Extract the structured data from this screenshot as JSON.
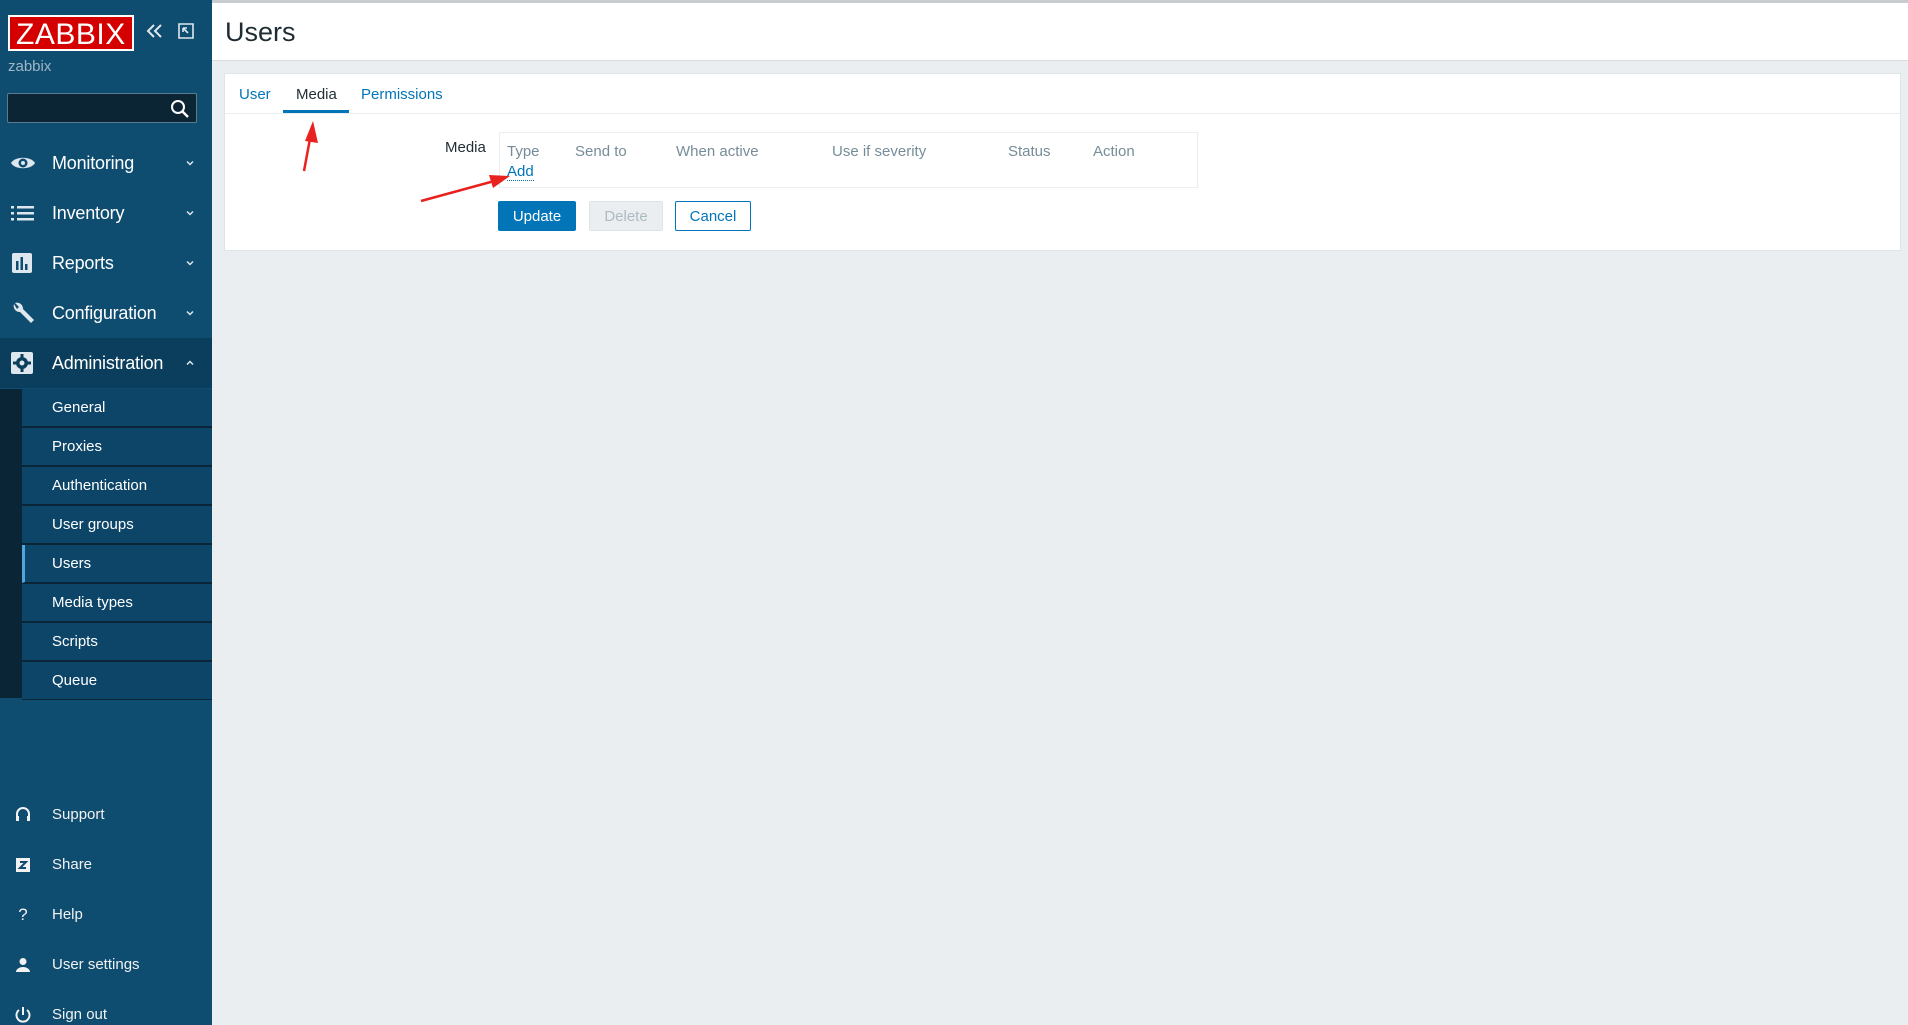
{
  "sidebar": {
    "logo": "ZABBIX",
    "server_name": "zabbix",
    "search": {
      "placeholder": "",
      "value": ""
    },
    "menu": [
      {
        "label": "Monitoring",
        "icon": "eye-icon"
      },
      {
        "label": "Inventory",
        "icon": "list-icon"
      },
      {
        "label": "Reports",
        "icon": "bar-chart-icon"
      },
      {
        "label": "Configuration",
        "icon": "wrench-icon"
      },
      {
        "label": "Administration",
        "icon": "gear-icon",
        "expanded": true
      }
    ],
    "submenu": [
      {
        "label": "General"
      },
      {
        "label": "Proxies"
      },
      {
        "label": "Authentication"
      },
      {
        "label": "User groups"
      },
      {
        "label": "Users",
        "active": true
      },
      {
        "label": "Media types"
      },
      {
        "label": "Scripts"
      },
      {
        "label": "Queue"
      }
    ],
    "bottom": [
      {
        "label": "Support",
        "icon": "headset-icon"
      },
      {
        "label": "Share",
        "icon": "share-z-icon"
      },
      {
        "label": "Help",
        "icon": "help-icon"
      },
      {
        "label": "User settings",
        "icon": "user-icon"
      },
      {
        "label": "Sign out",
        "icon": "power-icon"
      }
    ]
  },
  "header": {
    "title": "Users"
  },
  "tabs": [
    {
      "label": "User"
    },
    {
      "label": "Media",
      "active": true
    },
    {
      "label": "Permissions"
    }
  ],
  "media_form": {
    "label": "Media",
    "columns": [
      "Type",
      "Send to",
      "When active",
      "Use if severity",
      "Status",
      "Action"
    ],
    "add_link": "Add"
  },
  "buttons": {
    "update": "Update",
    "delete": "Delete",
    "cancel": "Cancel"
  },
  "colors": {
    "sidebar_bg": "#0e4c70",
    "accent": "#0275b8",
    "logo_red": "#d40000",
    "annotation_arrow": "#e8231f"
  }
}
